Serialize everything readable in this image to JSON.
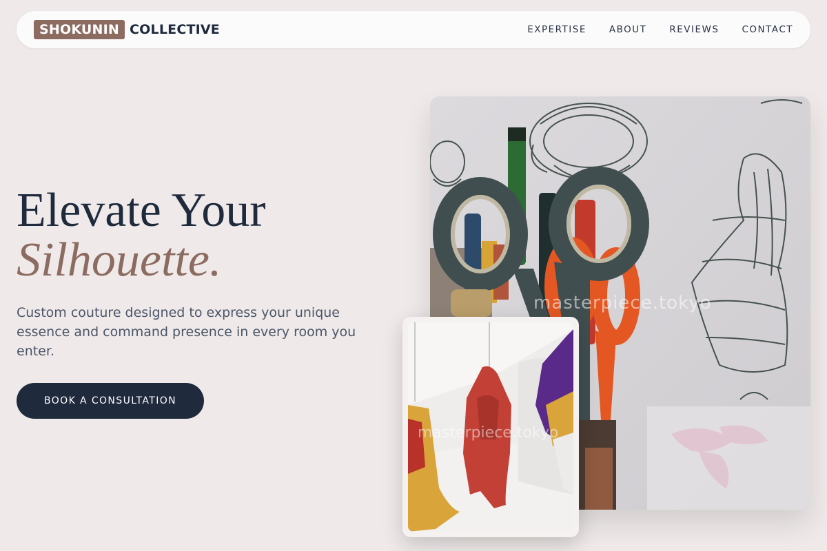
{
  "header": {
    "logo_highlight": "SHOKUNIN",
    "logo_rest": "COLLECTIVE",
    "nav": [
      {
        "label": "EXPERTISE"
      },
      {
        "label": "ABOUT"
      },
      {
        "label": "REVIEWS"
      },
      {
        "label": "CONTACT"
      }
    ]
  },
  "hero": {
    "title_line1": "Elevate Your",
    "title_line2": "Silhouette.",
    "subtitle": "Custom couture designed to express your unique essence and command presence in every room you enter.",
    "cta_label": "BOOK A CONSULTATION"
  },
  "images": {
    "main_watermark": "masterpiece.tokyo",
    "small_watermark": "masterpiece.tokyo"
  },
  "colors": {
    "background": "#efeae9",
    "navy": "#1f2a3d",
    "accent": "#8c6b60"
  }
}
